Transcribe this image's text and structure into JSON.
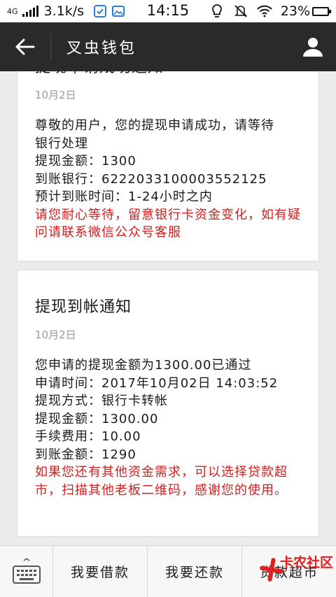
{
  "status_bar": {
    "network_type": "4G",
    "speed": "3.1k/s",
    "time": "14:15",
    "battery": "23%",
    "battery_level": 0.23,
    "battery_color": "#2faa2f"
  },
  "header": {
    "title": "叉虫钱包",
    "background": "#2a2a2c"
  },
  "messages": [
    {
      "title": "提现申请成功通知",
      "date": "10月2日",
      "lines": [
        "尊敬的用户，您的提现申请成功，请等待",
        "银行处理",
        "提现金额：1300",
        "到账银行：6222033100003552125",
        "预计到账时间：1-24小时之内"
      ],
      "note": "请您耐心等待，留意银行卡资金变化，如有疑问请联系微信公众号客服"
    },
    {
      "title": "提现到帐通知",
      "date": "10月2日",
      "lines": [
        "您申请的提现金额为1300.00已通过",
        "申请时间：2017年10月02日 14:03:52",
        "提现方式：银行卡转帐",
        "提现金额：1300.00",
        "手续费用：10.00",
        "到账金额：1290"
      ],
      "note": "如果您还有其他资金需求，可以选择贷款超市，扫描其他老板二维码，感谢您的使用。"
    }
  ],
  "bottom_menu": {
    "items": [
      "我要借款",
      "我要还款",
      "贷款超市"
    ]
  },
  "watermark": {
    "text": "卡农社区",
    "color": "#e02020"
  }
}
